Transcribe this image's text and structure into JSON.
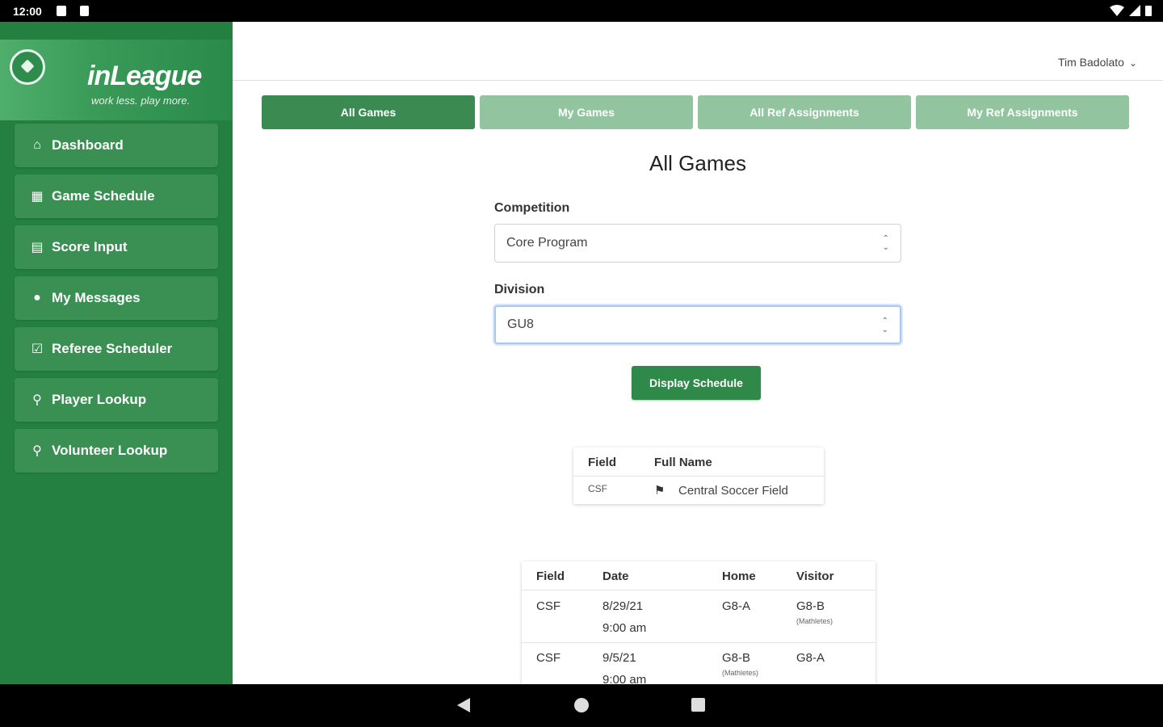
{
  "status_bar": {
    "time": "12:00"
  },
  "brand": {
    "logo": "inLeague",
    "tagline": "work less. play more."
  },
  "sidebar": {
    "items": [
      {
        "label": "Dashboard",
        "icon": "home-icon"
      },
      {
        "label": "Game Schedule",
        "icon": "calendar-icon"
      },
      {
        "label": "Score Input",
        "icon": "clipboard-icon"
      },
      {
        "label": "My Messages",
        "icon": "chat-icon"
      },
      {
        "label": "Referee Scheduler",
        "icon": "clipboard-check-icon"
      },
      {
        "label": "Player Lookup",
        "icon": "search-icon"
      },
      {
        "label": "Volunteer Lookup",
        "icon": "search-icon"
      }
    ]
  },
  "header": {
    "user_name": "Tim Badolato"
  },
  "tabs": [
    {
      "label": "All Games",
      "active": true
    },
    {
      "label": "My Games",
      "active": false
    },
    {
      "label": "All Ref Assignments",
      "active": false
    },
    {
      "label": "My Ref Assignments",
      "active": false
    }
  ],
  "page": {
    "title": "All Games"
  },
  "form": {
    "competition_label": "Competition",
    "competition_value": "Core Program",
    "division_label": "Division",
    "division_value": "GU8",
    "submit_label": "Display Schedule"
  },
  "fields_table": {
    "headers": [
      "Field",
      "Full Name"
    ],
    "rows": [
      {
        "field": "CSF",
        "full_name": "Central Soccer Field"
      }
    ]
  },
  "games_table": {
    "headers": [
      "Field",
      "Date",
      "Home",
      "Visitor"
    ],
    "rows": [
      {
        "field": "CSF",
        "date": "8/29/21",
        "time": "9:00 am",
        "home": "G8-A",
        "home_note": "",
        "visitor": "G8-B",
        "visitor_note": "(Mathletes)"
      },
      {
        "field": "CSF",
        "date": "9/5/21",
        "time": "9:00 am",
        "home": "G8-B",
        "home_note": "(Mathletes)",
        "visitor": "G8-A",
        "visitor_note": ""
      }
    ]
  },
  "colors": {
    "sidebar": "#238040",
    "active_tab": "#3a8a52",
    "inactive_tab": "#93c4a0"
  }
}
